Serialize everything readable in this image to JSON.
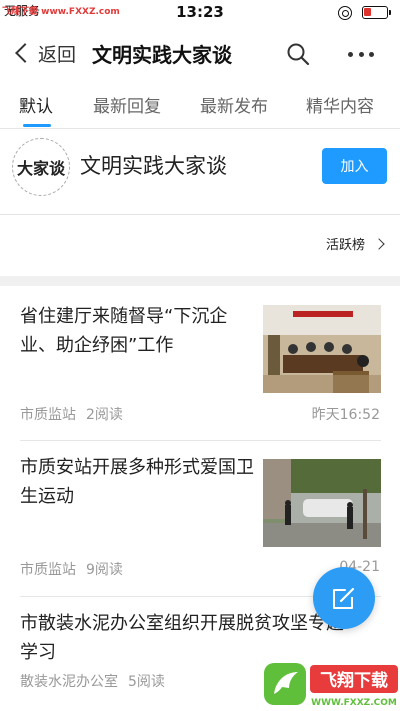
{
  "status_bar": {
    "carrier": "无服务",
    "watermark": "飞翔下载 www.FXXZ.com",
    "time": "13:23"
  },
  "nav": {
    "back_label": "返回",
    "title": "文明实践大家谈"
  },
  "tabs": [
    {
      "label": "默认",
      "active": true
    },
    {
      "label": "最新回复",
      "active": false
    },
    {
      "label": "最新发布",
      "active": false
    },
    {
      "label": "精华内容",
      "active": false
    }
  ],
  "forum": {
    "logo_text": "大家谈",
    "name": "文明实践大家谈",
    "join_label": "加入"
  },
  "active_rank_label": "活跃榜",
  "posts": [
    {
      "title": "省住建厅来随督导“下沉企业、助企纾困”工作",
      "source": "市质监站",
      "reads": "2阅读",
      "time": "昨天16:52"
    },
    {
      "title": "市质安站开展多种形式爱国卫生运动",
      "source": "市质监站",
      "reads": "9阅读",
      "time": "04-21"
    },
    {
      "title": "市散装水泥办公室组织开展脱贫攻坚专题学习",
      "source": "散装水泥办公室",
      "reads": "5阅读",
      "time": ""
    }
  ],
  "site_logo": {
    "main": "飞翔下载",
    "sub": "WWW.FXXZ.COM"
  },
  "colors": {
    "accent": "#1f9bff",
    "fab": "#2d9cf5",
    "meta_text": "#999999",
    "watermark": "#e23b3b"
  },
  "icons": [
    "back-chevron-icon",
    "search-icon",
    "more-icon",
    "chevron-right-icon",
    "edit-icon",
    "lock-rotation-icon",
    "battery-icon"
  ]
}
